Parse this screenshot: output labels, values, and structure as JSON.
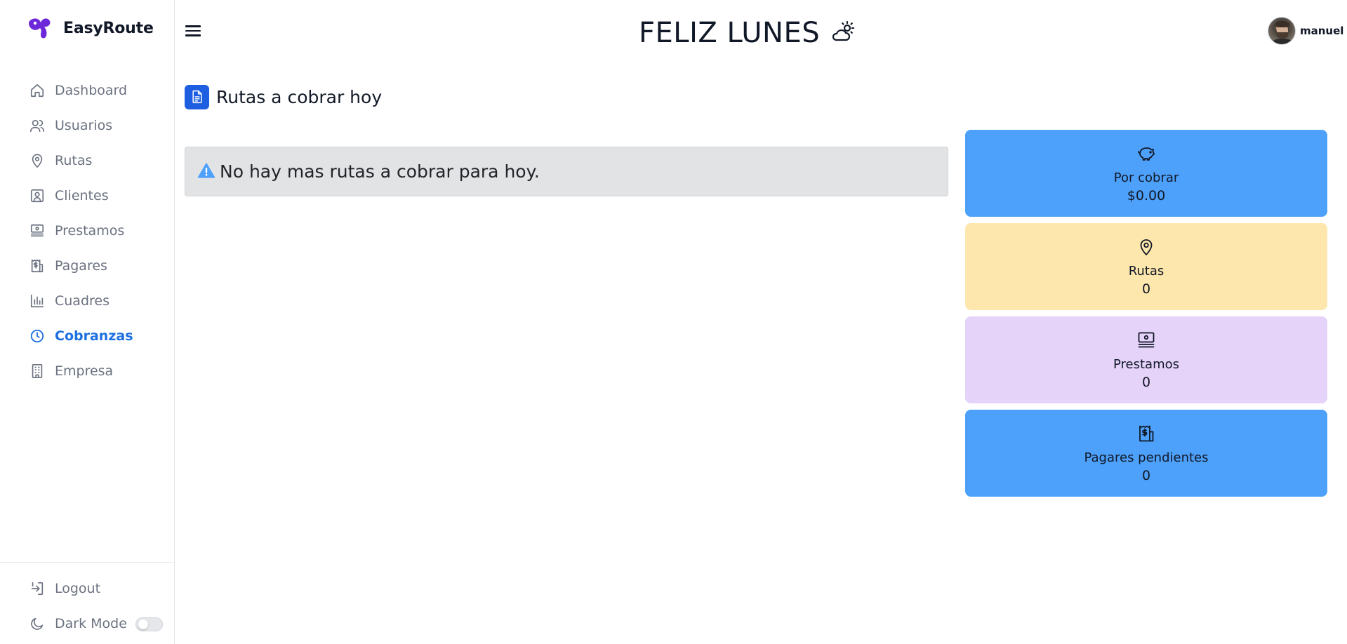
{
  "brand": {
    "name": "EasyRoute",
    "logo_icon": "easyroute-logo-icon",
    "logo_color": "#6d28d9"
  },
  "sidebar": {
    "items": [
      {
        "label": "Dashboard",
        "icon": "home-icon",
        "active": false
      },
      {
        "label": "Usuarios",
        "icon": "users-icon",
        "active": false
      },
      {
        "label": "Rutas",
        "icon": "map-pin-icon",
        "active": false
      },
      {
        "label": "Clientes",
        "icon": "contact-card-icon",
        "active": false
      },
      {
        "label": "Prestamos",
        "icon": "cash-icon",
        "active": false
      },
      {
        "label": "Pagares",
        "icon": "receipt-icon",
        "active": false
      },
      {
        "label": "Cuadres",
        "icon": "bar-chart-icon",
        "active": false
      },
      {
        "label": "Cobranzas",
        "icon": "clock-icon",
        "active": true
      },
      {
        "label": "Empresa",
        "icon": "building-icon",
        "active": false
      }
    ],
    "logout_label": "Logout",
    "dark_mode_label": "Dark Mode",
    "dark_mode_on": false
  },
  "header": {
    "greeting": "FELIZ LUNES",
    "weather_icon": "cloud-sun-icon",
    "user_name": "manuel"
  },
  "main": {
    "section_title": "Rutas a cobrar hoy",
    "alert_text": "No hay mas rutas a cobrar para hoy.",
    "cards": [
      {
        "label": "Por cobrar",
        "value": "$0.00",
        "icon": "piggy-bank-icon",
        "color": "#4ea1fb"
      },
      {
        "label": "Rutas",
        "value": "0",
        "icon": "map-pin-icon",
        "color": "#fee7ac"
      },
      {
        "label": "Prestamos",
        "value": "0",
        "icon": "cash-icon",
        "color": "#e6d3fa"
      },
      {
        "label": "Pagares pendientes",
        "value": "0",
        "icon": "receipt-icon",
        "color": "#4ea1fb"
      }
    ]
  },
  "colors": {
    "accent": "#1d6fe0",
    "section_badge": "#1d5fe0",
    "alert_bg": "#e2e3e5",
    "alert_icon": "#4ea1fb"
  }
}
